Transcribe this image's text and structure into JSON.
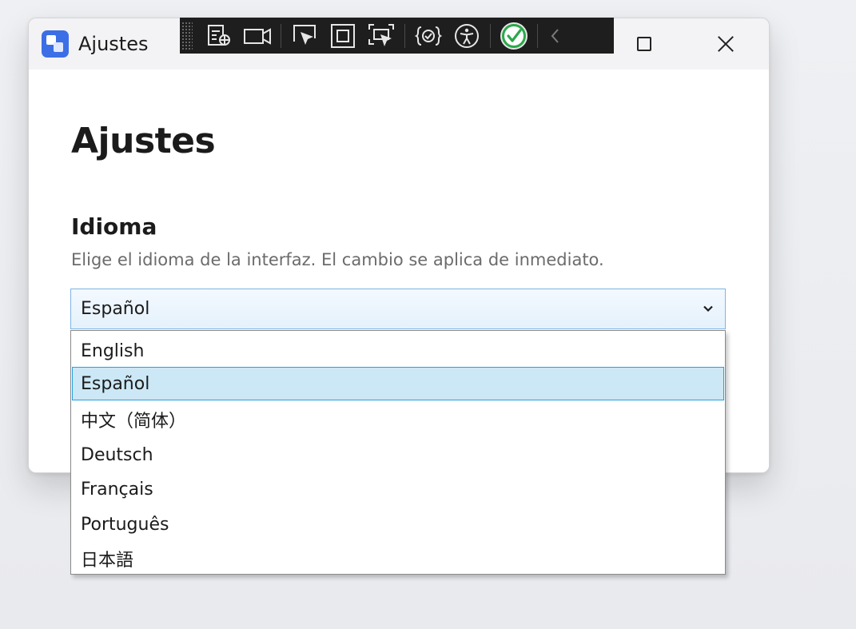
{
  "window": {
    "title": "Ajustes",
    "controls": {
      "maximize_icon": "maximize-icon",
      "close_icon": "close-icon"
    }
  },
  "devtools": {
    "tools": [
      "live-visual-tree-icon",
      "record-icon",
      "select-element-icon",
      "display-layout-adorners-icon",
      "track-focus-icon",
      "binding-failures-icon",
      "accessibility-icon",
      "accessibility-checker-icon",
      "collapse-icon"
    ]
  },
  "page": {
    "title": "Ajustes"
  },
  "language_section": {
    "title": "Idioma",
    "description": "Elige el idioma de la interfaz. El cambio se aplica de inmediato.",
    "selected": "Español",
    "options": [
      "English",
      "Español",
      "中文（简体）",
      "Deutsch",
      "Français",
      "Português",
      "日本語"
    ],
    "selected_index": 1
  },
  "colors": {
    "accent": "#3c6fe6",
    "selection_bg": "#cce8f6",
    "selection_border": "#26a0da",
    "focus_border": "#7fb4e5"
  }
}
